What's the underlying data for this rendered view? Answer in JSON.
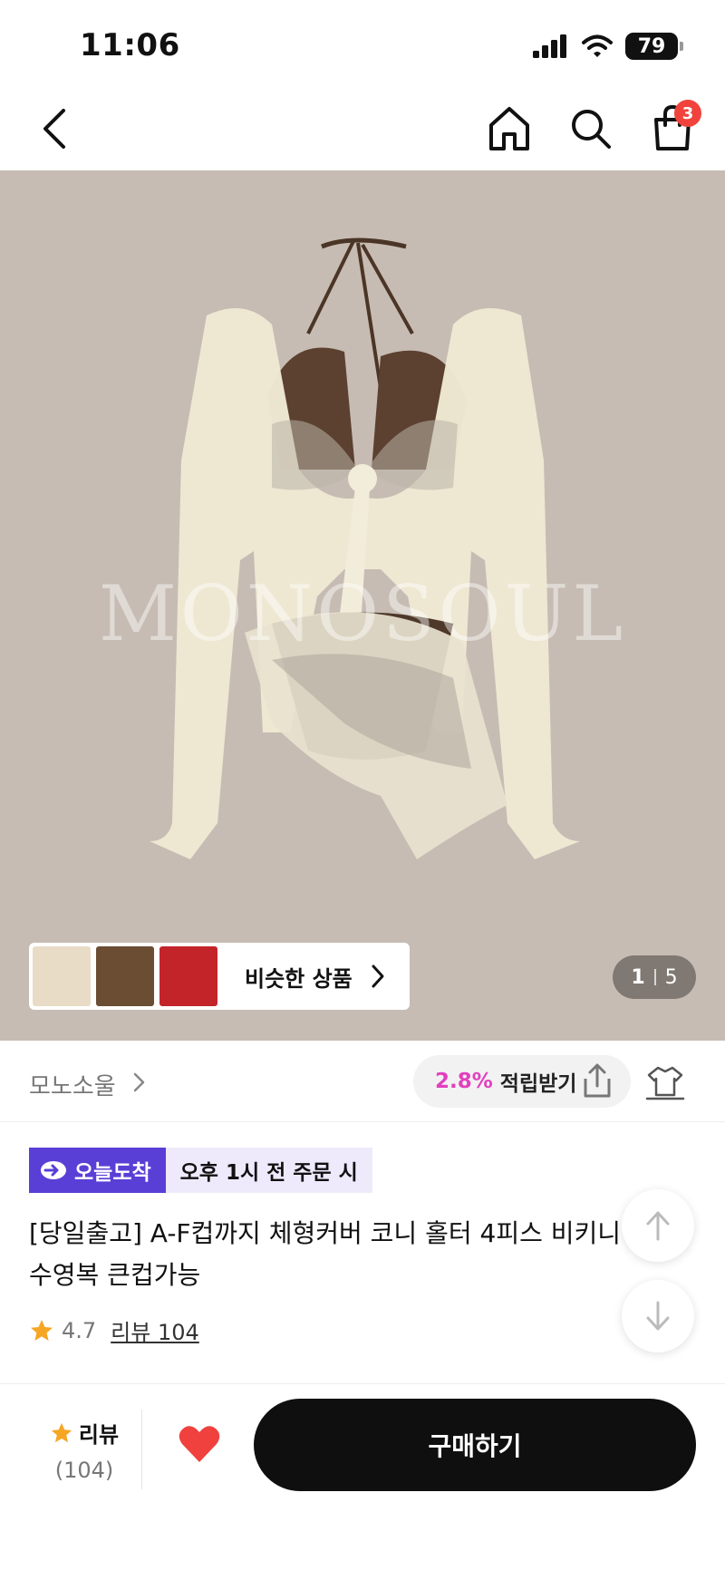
{
  "status_bar": {
    "time": "11:06",
    "battery": "79"
  },
  "nav": {
    "cart_count": "3"
  },
  "gallery": {
    "watermark": "MONOSOUL",
    "similar_label": "비슷한 상품",
    "page_current": "1",
    "page_total": "5"
  },
  "brand": {
    "name": "모노소울",
    "reward_rate": "2.8%",
    "reward_label": "적립받기"
  },
  "delivery": {
    "badge": "오늘도착",
    "text": "오후 1시 전 주문 시"
  },
  "product": {
    "title": "[당일출고] A-F컵까지 체형커버 코니 홀터 4피스 비키니 수영복 큰컵가능",
    "rating": "4.7",
    "review_link": "리뷰 104"
  },
  "bottom_bar": {
    "review_label": "리뷰",
    "review_count": "(104)",
    "buy_label": "구매하기"
  },
  "colors": {
    "accent_purple": "#5a3fd6",
    "reward_pink": "#e23fbf",
    "badge_red": "#f1433c",
    "heart_red": "#f0413f",
    "star_orange": "#f6a623"
  }
}
